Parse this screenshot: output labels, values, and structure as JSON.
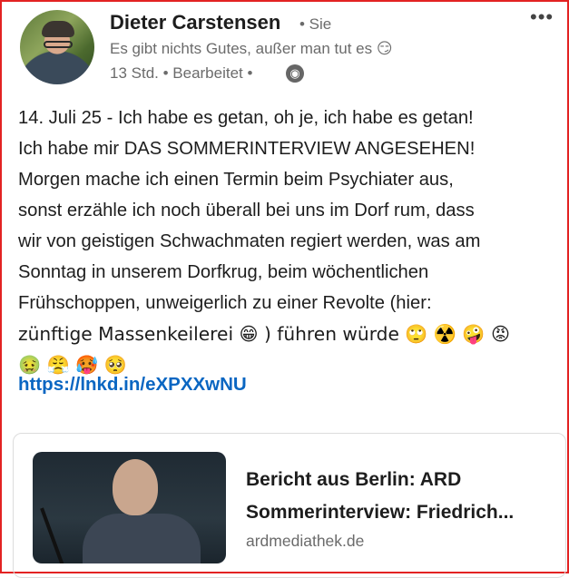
{
  "author": {
    "name": "Dieter Carstensen",
    "you_label": "• Sie",
    "tagline": "Es gibt nichts Gutes, außer man tut es 😏",
    "meta": "13 Std. • Bearbeitet •"
  },
  "post": {
    "line1": "14. Juli 25 - Ich habe es getan, oh je, ich habe es getan!",
    "line2": "Ich habe mir DAS SOMMERINTERVIEW ANGESEHEN!",
    "line3": "Morgen mache ich einen Termin beim Psychiater aus,",
    "line4": "sonst erzähle ich noch überall bei uns im Dorf rum, dass",
    "line5": "wir von geistigen Schwachmaten regiert werden, was am",
    "line6": "Sonntag in unserem Dorfkrug, beim wöchentlichen",
    "line7": "Frühschoppen, unweigerlich zu einer Revolte (hier:",
    "line8": "zünftige Massenkeilerei 😁 ) führen würde 🙄 ☢️ 🤪 😡",
    "line9": "🤢 😤 🥵 🥺",
    "link": "https://lnkd.in/eXPXXwNU"
  },
  "preview": {
    "title_line1": "Bericht aus Berlin: ARD",
    "title_line2": "Sommerinterview: Friedrich...",
    "domain": "ardmediathek.de"
  },
  "icons": {
    "more": "more-options-icon",
    "visibility": "globe-icon"
  },
  "colors": {
    "link": "#0a66c2",
    "frame": "#e32222",
    "muted": "#6b6b6b"
  }
}
